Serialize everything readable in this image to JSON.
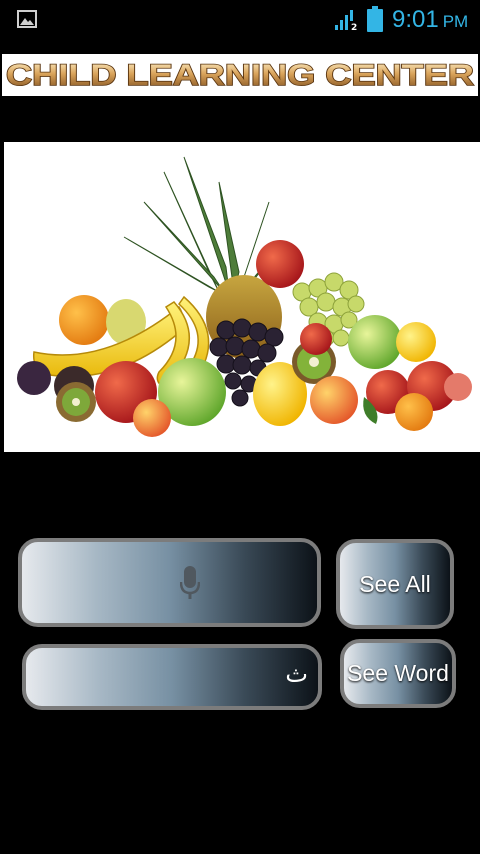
{
  "status_bar": {
    "time": "9:01",
    "ampm": "PM",
    "icons": [
      "gallery-icon",
      "signal-icon",
      "battery-icon"
    ],
    "accent": "#33b5e5"
  },
  "banner": {
    "title": "CHILD LEARNING CENTER"
  },
  "main_image": {
    "subject": "fruit-basket-photo"
  },
  "voice_input": {
    "icon": "microphone-icon",
    "value": ""
  },
  "text_input": {
    "value": "ث"
  },
  "buttons": {
    "see_all": "See All",
    "see_word": "See Word"
  },
  "colors": {
    "background": "#000000",
    "button_border": "#7c7c7c",
    "button_gradient": [
      "#e6e9ed",
      "#7790a3",
      "#0c1218"
    ]
  }
}
